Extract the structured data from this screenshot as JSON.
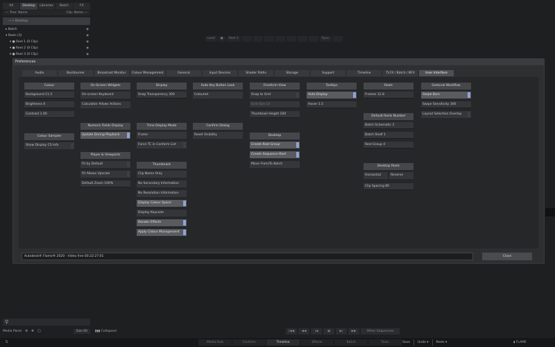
{
  "top_tabs": [
    "All",
    "Desktop",
    "Libraries",
    "Batch",
    "FX"
  ],
  "tree_header": {
    "left": "— Tree: Name",
    "right": "Clip: Name —"
  },
  "tree_root": "—→ Desktop",
  "tree_items": [
    {
      "label": "▸ Batch",
      "indent": 0
    },
    {
      "label": "▾ Reels (3)",
      "indent": 0
    },
    {
      "label": "▾ ● Reel 1 (0 Clip)",
      "indent": 1
    },
    {
      "label": "▾ ● Reel 2 (0 Clip)",
      "indent": 1
    },
    {
      "label": "▾ ● Reel 3 (0 Clip)",
      "indent": 1
    }
  ],
  "reel_bar": [
    "Load",
    "●",
    "Reel 1",
    "",
    "",
    "",
    "",
    "",
    "",
    "",
    "Sync",
    ""
  ],
  "preferences": {
    "title": "Preferences",
    "tabs": [
      "Audio",
      "Backburner",
      "Broadcast Monitor",
      "Colour Management",
      "General",
      "Input Devices",
      "Shader Paths",
      "Storage",
      "Support",
      "Timeline",
      "TLFX / Batch / BFX",
      "User Interface"
    ],
    "active_tab": "User Interface",
    "colour": {
      "header": "Colour",
      "background": "Background 11.5",
      "brightness": "Brightness 0",
      "contrast": "Contrast 1.00"
    },
    "colour_sampler": {
      "header": "Colour Sampler",
      "show_display": "Show Display CS Info"
    },
    "onscreen": {
      "header": "On-Screen Widgets",
      "keyboard": "On-screen Keyboard",
      "calculator": "Calculator Allows Actions"
    },
    "numeric": {
      "header": "Numeric Fields Display",
      "update": "Update During Playback"
    },
    "player": {
      "header": "Player & Viewports",
      "fit_default": "Fit by Default",
      "fit_upscale": "Fit Allows Upscale",
      "default_zoom": "Default Zoom 100%"
    },
    "display": {
      "header": "Display",
      "snap": "Snap Transparency 300"
    },
    "time_display": {
      "header": "Time Display Mode",
      "frame": "Frame",
      "force_tc": "Force TC in Conform List"
    },
    "thumbnails": {
      "header": "Thumbnails",
      "items": [
        {
          "label": "Clip Name Only",
          "toggle": false,
          "on": false
        },
        {
          "label": "No Secondary Information",
          "toggle": false,
          "on": false
        },
        {
          "label": "No Resolution Information",
          "toggle": false,
          "on": false
        },
        {
          "label": "Display Colour Space",
          "toggle": true,
          "on": true
        },
        {
          "label": "Display Keycode",
          "toggle": false,
          "on": false
        },
        {
          "label": "Render Effects",
          "toggle": true,
          "on": true
        },
        {
          "label": "Apply Colour Management",
          "toggle": true,
          "on": true
        }
      ]
    },
    "auto_key": {
      "header": "Auto Key Button Look",
      "coloured": "Coloured"
    },
    "confirm": {
      "header": "Confirm Dialog",
      "reset": "Reset Visibility"
    },
    "freeform": {
      "header": "Freeform View",
      "snap_grid": "Snap to Grid",
      "grid_size": "Grid Size 15",
      "thumb_height": "Thumbnail Height 100"
    },
    "desktop": {
      "header": "Desktop",
      "create_reel": "Create Reel Group",
      "create_seq": "Create Sequence Reel",
      "move_batch": "Move From/To Batch"
    },
    "tooltips": {
      "header": "Tooltips",
      "auto_display": "Auto Display",
      "hover": "Hover 1.5"
    },
    "reels": {
      "header": "Reels",
      "frames": "Frames 12.8"
    },
    "default_reels": {
      "header": "Default Reels Number",
      "schematic": "Batch Schematic 3",
      "shelf": "Batch Shelf 1",
      "reel_group": "Reel Group 4"
    },
    "desktop_reels": {
      "header": "Desktop Reels",
      "horizontal": "Horizontal",
      "reverse": "Reverse",
      "clip_spacing": "Clip Spacing 80"
    },
    "gestural": {
      "header": "Gestural Workflow",
      "swipe_bars": "Swipe Bars",
      "swipe_sens": "Swipe Sensitivity 300",
      "layout_sel": "Layout Selection Overlay"
    },
    "status": "Autodesk® Flame®   2020  - Video free 00:22:27:01",
    "close": "Close"
  },
  "bottom": {
    "media_panel": "Media Panel",
    "size": "Size 00",
    "collapsed": "Collapsed",
    "transport": [
      "|◀◀",
      "◀◀",
      "|◀",
      "◀|",
      "▶|",
      "▶▶",
      "▶▶|"
    ],
    "other_sequences": "Other Sequences",
    "mode_tabs": [
      "Media Hub",
      "Conform",
      "Timeline",
      "Effects",
      "Batch",
      "Tools"
    ],
    "active_mode": "Timeline",
    "save": "Save",
    "undo": "Undo ▾",
    "reels": "Reels ▾",
    "logo": "◖ FLAME",
    "corner": "S"
  }
}
